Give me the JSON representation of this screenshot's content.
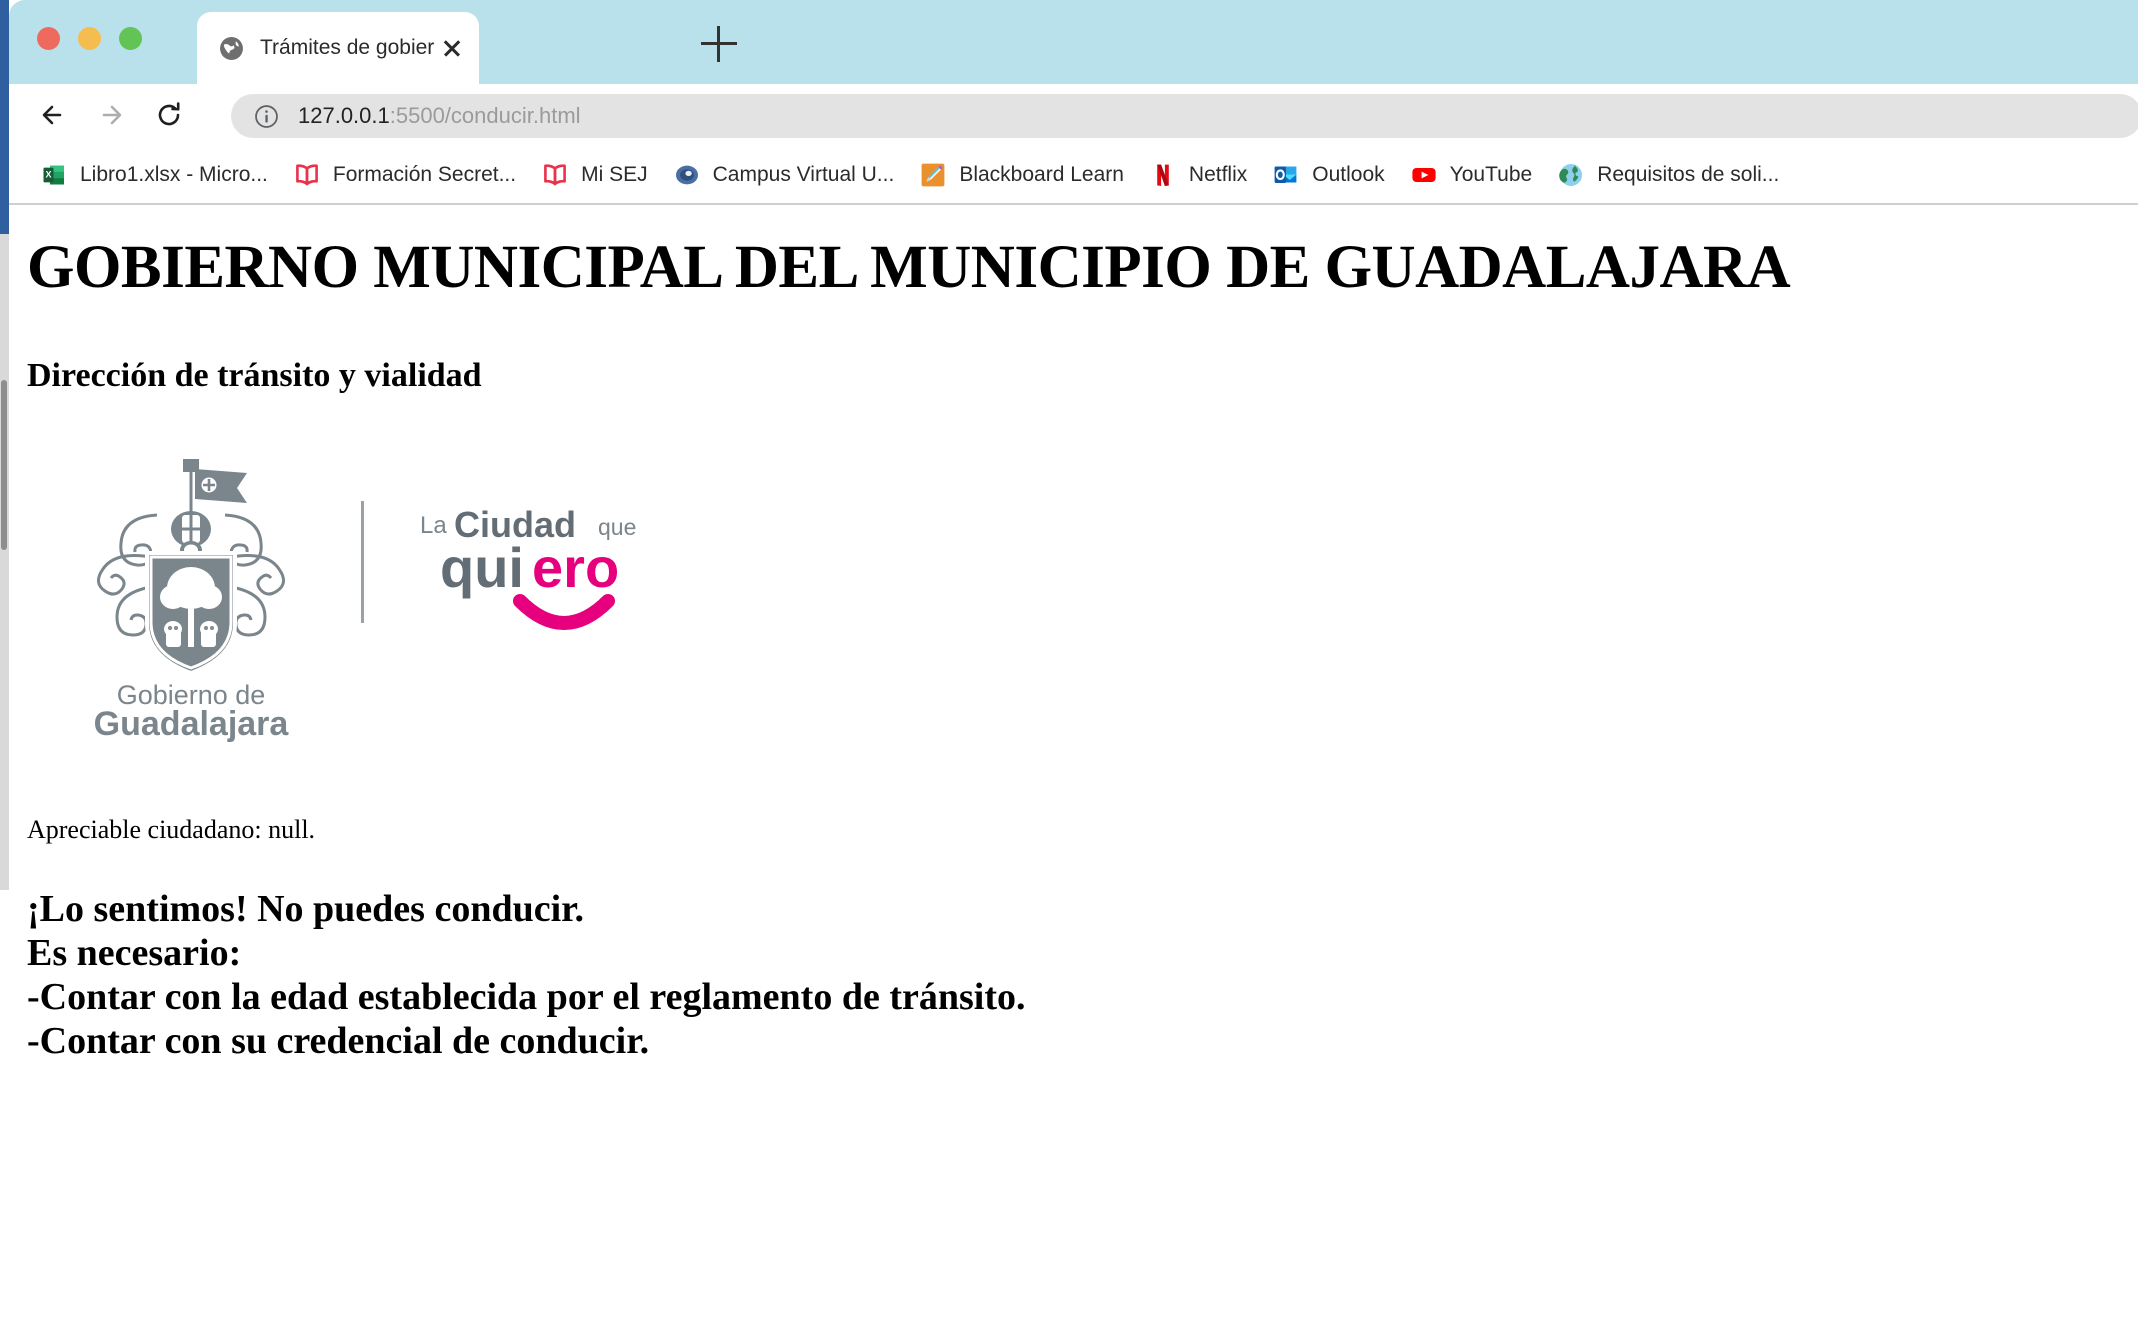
{
  "browser": {
    "window_controls": [
      "close",
      "minimize",
      "maximize"
    ],
    "tab": {
      "title": "Trámites de gobierno",
      "favicon": "globe-icon",
      "close_label": "×"
    },
    "new_tab_label": "+",
    "nav": {
      "back": "back-arrow-icon",
      "forward": "forward-arrow-icon",
      "reload": "reload-icon"
    },
    "omnibox": {
      "security_icon": "info-circle-icon",
      "url_host": "127.0.0.1",
      "url_rest": ":5500/conducir.html",
      "full_url": "127.0.0.1:5500/conducir.html"
    },
    "bookmarks": [
      {
        "label": "Libro1.xlsx - Micro...",
        "icon": "excel-icon"
      },
      {
        "label": "Formación Secret...",
        "icon": "book-icon"
      },
      {
        "label": "Mi SEJ",
        "icon": "book-icon"
      },
      {
        "label": "Campus Virtual U...",
        "icon": "moodle-icon"
      },
      {
        "label": "Blackboard Learn",
        "icon": "pencil-icon"
      },
      {
        "label": "Netflix",
        "icon": "netflix-icon"
      },
      {
        "label": "Outlook",
        "icon": "outlook-icon"
      },
      {
        "label": "YouTube",
        "icon": "youtube-icon"
      },
      {
        "label": "Requisitos de soli...",
        "icon": "globe-earth-icon"
      }
    ]
  },
  "colors": {
    "tabstrip": "#b9e1ec",
    "omnibox": "#e3e3e3",
    "book_icon": "#e8334a",
    "netflix_red": "#e50914",
    "youtube_red": "#ff0000",
    "excel_green": "#1e7145",
    "outlook_blue": "#0f6cbd",
    "logo_gray": "#7b858c",
    "logo_magenta": "#e6007e"
  },
  "page": {
    "title": "GOBIERNO MUNICIPAL DEL MUNICIPIO DE GUADALAJARA",
    "subtitle": "Dirección de tránsito y vialidad",
    "logo": {
      "crest_line1": "Gobierno de",
      "crest_line2": "Guadalajara",
      "slogan_la": "La",
      "slogan_ciudad": "Ciudad",
      "slogan_que": "que",
      "slogan_qui": "qui",
      "slogan_ero": "ero"
    },
    "greeting": "Apreciable ciudadano: null.",
    "notice_lines": [
      "¡Lo sentimos! No puedes conducir.",
      "Es necesario:",
      "-Contar con la edad establecida por el reglamento de tránsito.",
      "-Contar con su credencial de conducir."
    ]
  }
}
